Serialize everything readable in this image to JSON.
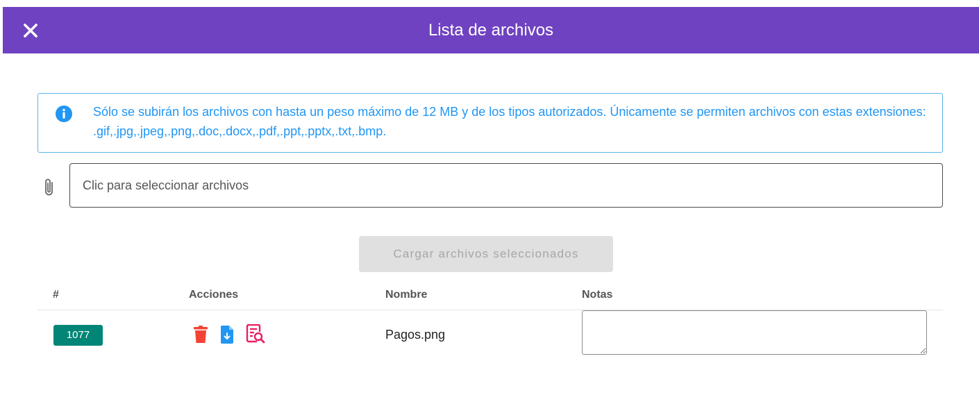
{
  "header": {
    "title": "Lista de archivos",
    "close_icon": "close-icon",
    "background_color": "#6f42c1"
  },
  "alert": {
    "icon": "info-icon",
    "text": "Sólo se subirán los archivos con hasta un peso máximo de 12 MB y de los tipos autorizados. Únicamente se permiten archivos con estas extensiones: .gif,.jpg,.jpeg,.png,.doc,.docx,.pdf,.ppt,.pptx,.txt,.bmp.",
    "color": "#2196f3"
  },
  "file_selector": {
    "icon": "paperclip-icon",
    "placeholder": "Clic para seleccionar archivos"
  },
  "upload_button": {
    "label": "Cargar archivos seleccionados",
    "disabled": true
  },
  "table": {
    "columns": [
      "#",
      "Acciones",
      "Nombre",
      "Notas"
    ],
    "rows": [
      {
        "id": "1077",
        "actions": [
          "trash-icon",
          "download-file-icon",
          "preview-file-icon"
        ],
        "name": "Pagos.png",
        "notes": ""
      }
    ]
  }
}
